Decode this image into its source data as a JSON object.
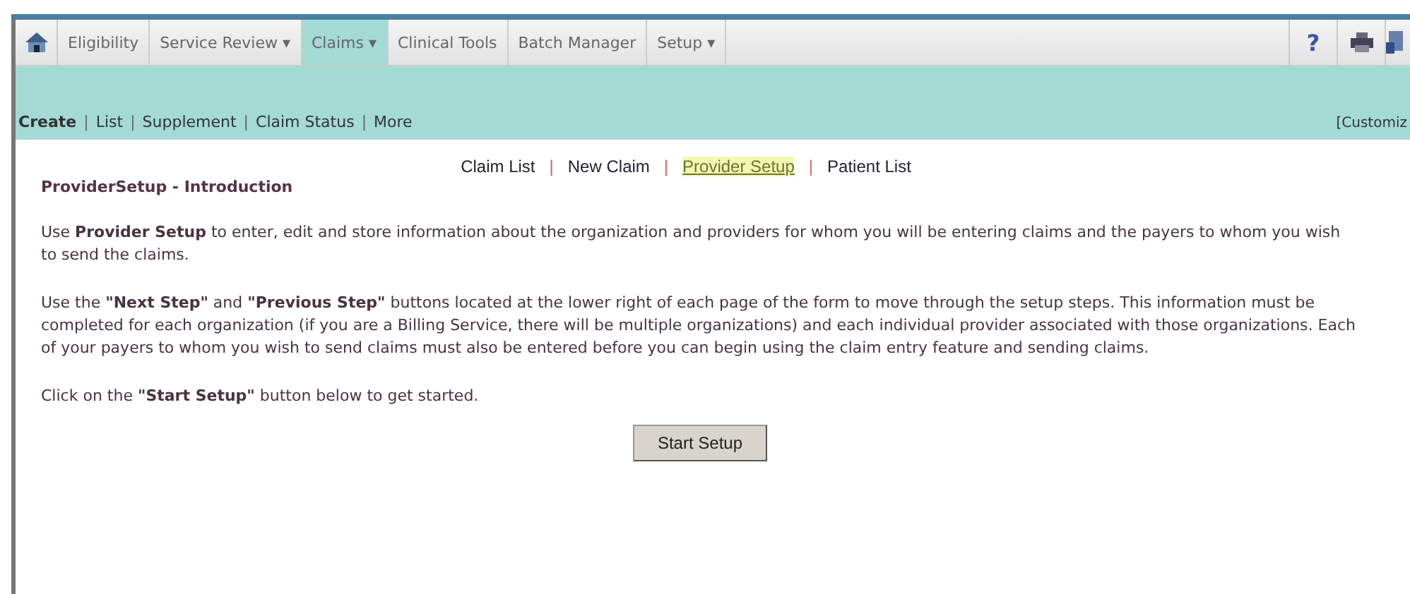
{
  "tabs": [
    {
      "label": "Eligibility",
      "selected": false
    },
    {
      "label": "Service Review ▾",
      "selected": false
    },
    {
      "label": "Claims ▾",
      "selected": true
    },
    {
      "label": "Clinical Tools",
      "selected": false
    },
    {
      "label": "Batch Manager",
      "selected": false
    },
    {
      "label": "Setup ▾",
      "selected": false
    }
  ],
  "help_icon": "?",
  "separator": "|",
  "subnav": {
    "items": [
      {
        "label": "Create",
        "selected": true
      },
      {
        "label": "List",
        "selected": false
      },
      {
        "label": "Supplement",
        "selected": false
      },
      {
        "label": "Claim Status",
        "selected": false
      },
      {
        "label": "More",
        "selected": false
      }
    ],
    "customize": "[Customiz"
  },
  "page_links": [
    {
      "label": "Claim List",
      "selected": false
    },
    {
      "label": "New Claim",
      "selected": false
    },
    {
      "label": "Provider Setup",
      "selected": true
    },
    {
      "label": "Patient List",
      "selected": false
    }
  ],
  "heading": "ProviderSetup - Introduction",
  "paragraphs": [
    {
      "text": "Use **Provider Setup** to enter, edit and store information about the organization and providers for whom you will be entering claims and the payers to whom you wish to send the claims."
    },
    {
      "text": "Use the **\"Next Step\"** and **\"Previous Step\"** buttons located at the lower right of each page of the form to move through the setup steps. This information must be completed for each organization (if you are a Billing Service, there will be multiple organizations) and each individual provider associated with those organizations. Each of your payers to whom you wish to send claims must also be entered before you can begin using the claim entry feature and sending claims."
    },
    {
      "text": "Click on the **\"Start Setup\"** button below to get started."
    }
  ],
  "start_button": "Start Setup"
}
